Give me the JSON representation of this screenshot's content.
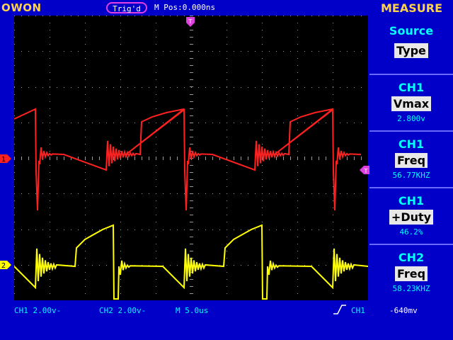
{
  "header": {
    "brand": "OWON",
    "trigger_status": "Trig'd",
    "m_pos": "M Pos:0.000ns",
    "measure_title": "MEASURE"
  },
  "markers": {
    "trigger_position": "T",
    "ch1_marker": "1",
    "ch2_marker": "2",
    "trigger_level": "T"
  },
  "measure_panel": {
    "source_label": "Source",
    "type_label": "Type",
    "items": [
      {
        "channel": "CH1",
        "type": "Vmax",
        "value": "2.800v"
      },
      {
        "channel": "CH1",
        "type": "Freq",
        "value": "56.77KHZ"
      },
      {
        "channel": "CH1",
        "type": "+Duty",
        "value": "46.2%"
      },
      {
        "channel": "CH2",
        "type": "Freq",
        "value": "58.23KHZ"
      }
    ]
  },
  "status_bar": {
    "ch1_scale": "CH1 2.00v-",
    "ch2_scale": "CH2 2.00v-",
    "timebase": "M 5.0us",
    "trigger_source": "CH1",
    "trigger_level_value": "-640mv"
  },
  "colors": {
    "ch1": "#ff2020",
    "ch2": "#ffff00",
    "background": "#0000c8",
    "screen": "#000000",
    "text_accent": "#00ffff",
    "title": "#ffd24a",
    "marker": "#e040e0"
  },
  "chart_data": {
    "type": "line",
    "series": [
      {
        "channel": "CH1",
        "color": "#ff2020"
      },
      {
        "channel": "CH2",
        "color": "#ffff00"
      }
    ]
  }
}
